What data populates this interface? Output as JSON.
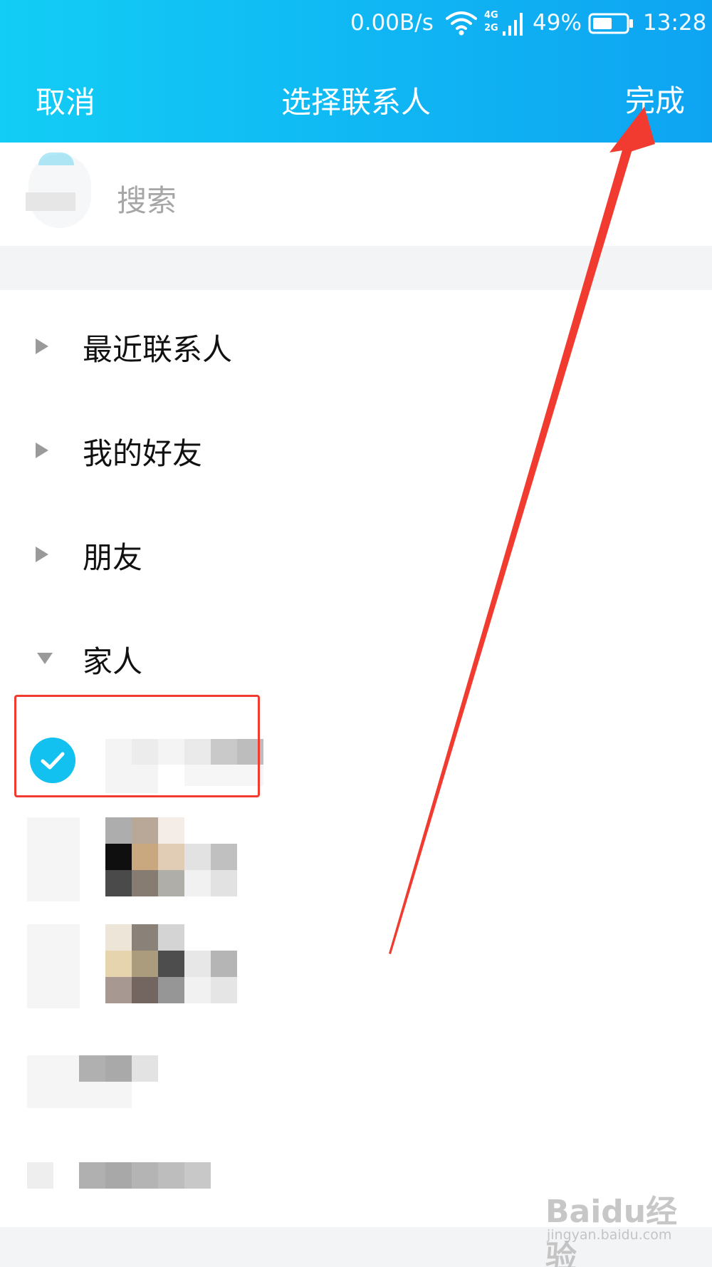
{
  "status_bar": {
    "speed": "0.00B/s",
    "battery_percent": "49%",
    "time": "13:28",
    "network_top": "4G",
    "network_bottom": "2G",
    "icons": [
      "wifi-icon",
      "signal-icon",
      "battery-icon"
    ]
  },
  "nav": {
    "cancel_label": "取消",
    "title": "选择联系人",
    "done_label": "完成"
  },
  "search": {
    "placeholder": "搜索"
  },
  "groups": [
    {
      "label": "最近联系人",
      "expanded": false
    },
    {
      "label": "我的好友",
      "expanded": false
    },
    {
      "label": "朋友",
      "expanded": false
    },
    {
      "label": "家人",
      "expanded": true
    }
  ],
  "family_contacts": [
    {
      "name": "",
      "selected": true,
      "obscured": true
    },
    {
      "name": "",
      "selected": false,
      "obscured": true
    },
    {
      "name": "",
      "selected": false,
      "obscured": true
    },
    {
      "name": "",
      "selected": false,
      "obscured": true
    },
    {
      "name": "",
      "selected": false,
      "obscured": true
    }
  ],
  "watermark": {
    "brand": "Baidu经验",
    "url": "jingyan.baidu.com"
  },
  "colors": {
    "header_gradient_start": "#12cdf5",
    "header_gradient_end": "#0ea4f2",
    "checkmark": "#12c1f0",
    "annotation_red": "#f23b30"
  }
}
